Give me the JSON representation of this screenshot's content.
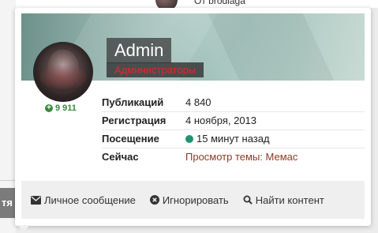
{
  "background": {
    "header_text": "От brodiaga",
    "left_button_label": "тя"
  },
  "profile": {
    "name": "Admin",
    "group": "Администраторы",
    "reputation": "9 911",
    "stats": [
      {
        "label": "Публикаций",
        "value": "4 840"
      },
      {
        "label": "Регистрация",
        "value": "4 ноября, 2013"
      },
      {
        "label": "Посещение",
        "value": "15 минут назад"
      },
      {
        "label": "Сейчас",
        "value": "Просмотр темы: Мемас"
      }
    ]
  },
  "actions": {
    "message": "Личное сообщение",
    "ignore": "Игнорировать",
    "find_content": "Найти контент"
  },
  "colors": {
    "group_color": "#e4262c",
    "reputation_color": "#3c8a3c",
    "online_dot": "#1d9371",
    "link_color": "#8a3b23"
  },
  "icons": {
    "reputation": "plus-circle-icon",
    "online": "online-dot-icon",
    "message": "envelope-icon",
    "ignore": "times-circle-icon",
    "find": "search-icon"
  }
}
